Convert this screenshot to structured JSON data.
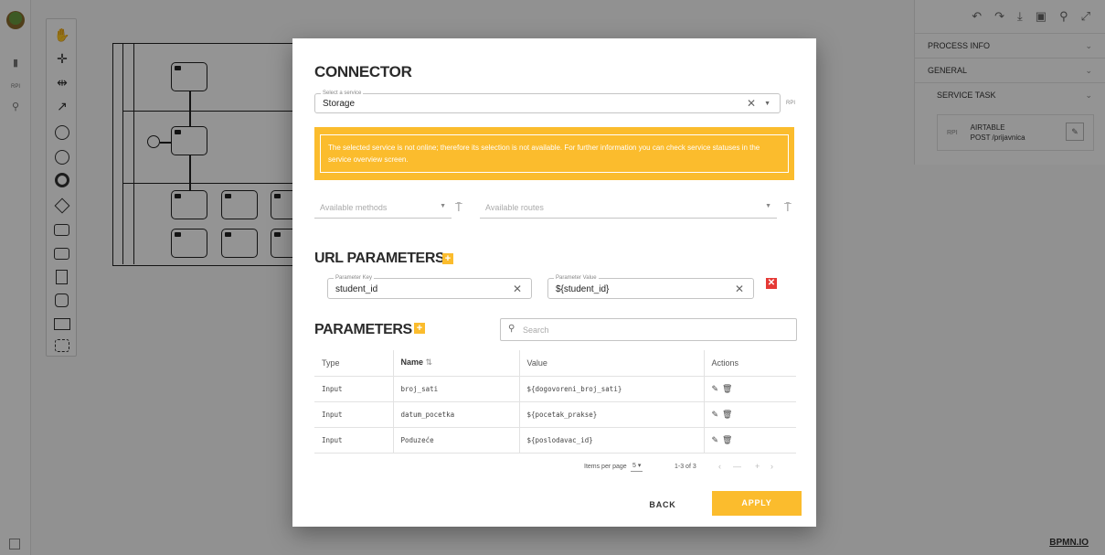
{
  "background": {
    "right_panel": {
      "process_info_label": "PROCESS INFO",
      "general_label": "GENERAL",
      "service_task_label": "SERVICE TASK",
      "card_tag": "RPI",
      "card_title": "AIRTABLE",
      "card_subtitle": "POST /prijavnica"
    },
    "left_strip_tag": "RPI",
    "bpmn_io_label": "BPMN.IO"
  },
  "modal": {
    "title": "CONNECTOR",
    "service_field": {
      "label": "Select a service",
      "value": "Storage",
      "tag": "RPI"
    },
    "warning_text": "The selected service is not online; therefore its selection is not available. For further information you can check service statuses in the service overview screen.",
    "methods_placeholder": "Available methods",
    "routes_placeholder": "Available routes",
    "url_params_title": "URL PARAMETERS",
    "url_param": {
      "key_label": "Parameter Key",
      "key_value": "student_id",
      "value_label": "Parameter Value",
      "value_value": "${student_id}"
    },
    "params_title": "PARAMETERS",
    "search_placeholder": "Search",
    "table": {
      "headers": [
        "Type",
        "Name",
        "Value",
        "Actions"
      ],
      "rows": [
        {
          "type": "Input",
          "name": "broj_sati",
          "value": "${dogovoreni_broj_sati}"
        },
        {
          "type": "Input",
          "name": "datum_pocetka",
          "value": "${pocetak_prakse}"
        },
        {
          "type": "Input",
          "name": "Poduzeće",
          "value": "${poslodavac_id}"
        }
      ]
    },
    "pagination": {
      "items_per_page_label": "Items per page",
      "items_per_page_value": "5",
      "range": "1-3 of 3"
    },
    "back_label": "BACK",
    "apply_label": "APPLY"
  },
  "colors": {
    "accent": "#fbbc2d",
    "danger": "#e53935"
  }
}
